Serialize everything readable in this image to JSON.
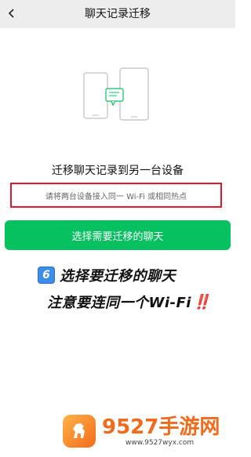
{
  "header": {
    "title": "聊天记录迁移",
    "back_icon": "chevron-left-icon"
  },
  "illustration": {
    "icon": "two-phones-transfer-icon",
    "accent": "#07c160"
  },
  "content": {
    "subtitle": "迁移聊天记录到另一台设备",
    "hint": "请将两台设备接入同一 Wi-Fi 或相同热点",
    "primary_button": "选择需要迁移的聊天"
  },
  "annotation": {
    "step_number": "6",
    "line1": "选择要迁移的聊天",
    "line2": "注意要连同一个Wi-Fi",
    "alert": "‼️",
    "highlight_color": "#e0182b"
  },
  "watermark": {
    "name": "9527手游网",
    "url": "www.9527wyx.com"
  },
  "colors": {
    "primary": "#07c160",
    "header_bg": "#ededed"
  }
}
